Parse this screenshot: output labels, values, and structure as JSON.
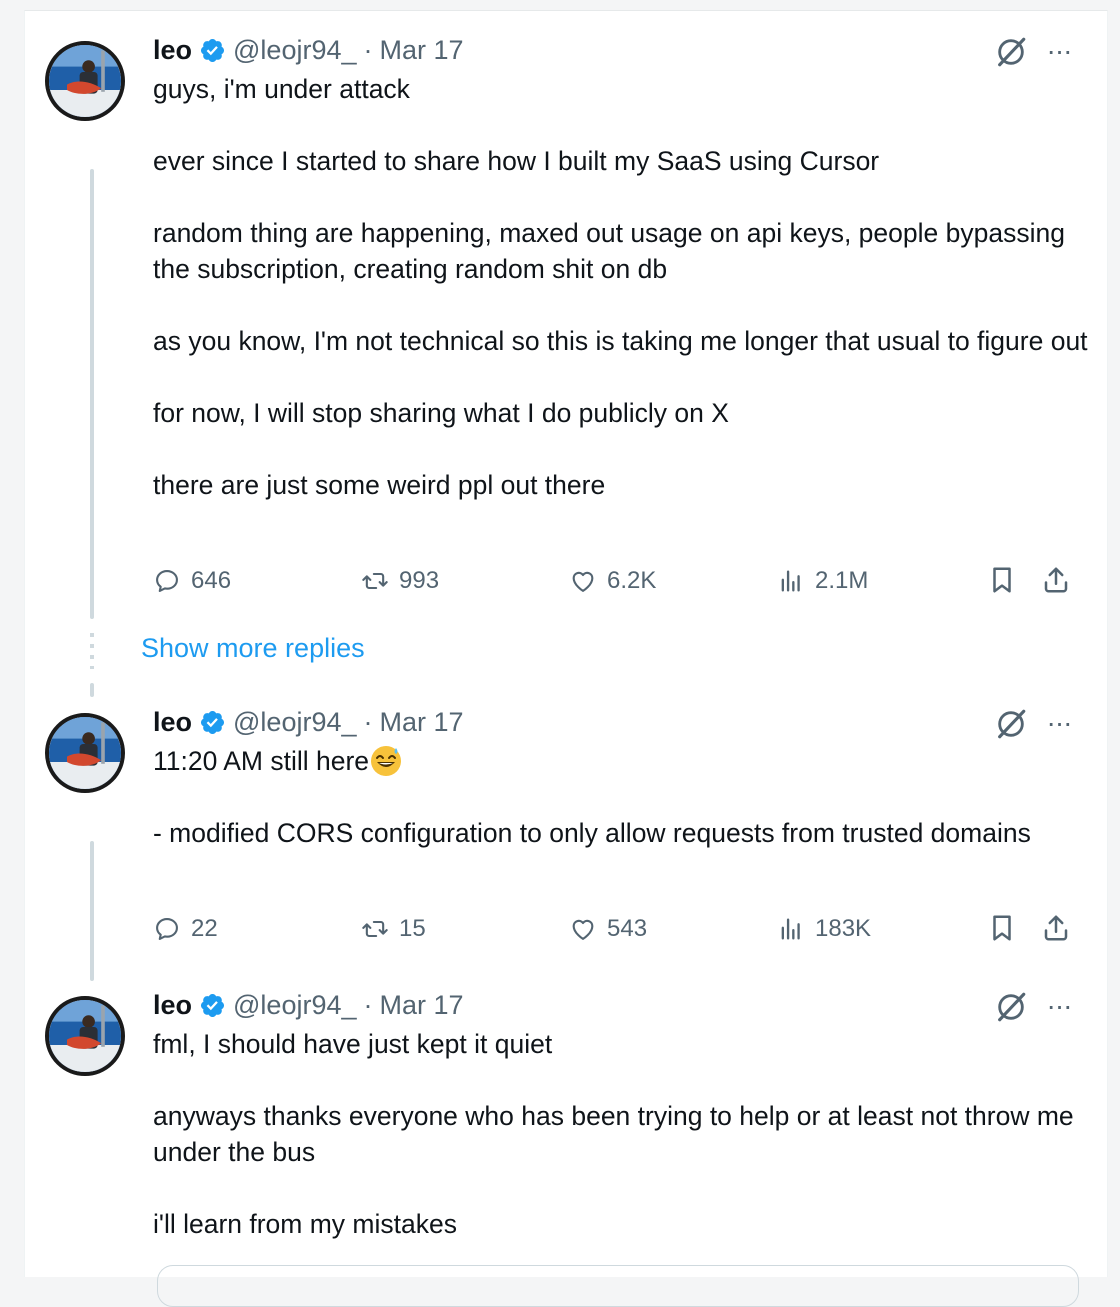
{
  "posts": [
    {
      "name": "leo",
      "handle": "@leojr94_",
      "separator": "·",
      "date": "Mar 17",
      "text": "guys, i'm under attack\n\never since I started to share how I built my SaaS using Cursor\n\nrandom thing are happening, maxed out usage on api keys, people bypassing the subscription, creating random shit on db\n\nas you know, I'm not technical so this is taking me longer that usual to figure out\n\nfor now, I will stop sharing what I do publicly on X\n\nthere are just some weird ppl out there",
      "replies": "646",
      "reposts": "993",
      "likes": "6.2K",
      "views": "2.1M"
    },
    {
      "name": "leo",
      "handle": "@leojr94_",
      "separator": "·",
      "date": "Mar 17",
      "text": "11:20 AM still here",
      "text2": "- modified CORS configuration to only allow requests from trusted domains",
      "replies": "22",
      "reposts": "15",
      "likes": "543",
      "views": "183K"
    },
    {
      "name": "leo",
      "handle": "@leojr94_",
      "separator": "·",
      "date": "Mar 17",
      "text": "fml, I should have just kept it quiet\n\nanyways thanks everyone who has been trying to help or at least not throw me under the bus\n\ni'll learn from my mistakes"
    }
  ],
  "show_more": "Show more replies",
  "more_glyph": "···",
  "colors": {
    "accent": "#1d9bf0",
    "text": "#0f1419",
    "muted": "#536471",
    "line": "#cfd9de"
  },
  "icons": [
    "verified-badge-icon",
    "grok-icon",
    "more-icon",
    "reply-icon",
    "repost-icon",
    "like-icon",
    "views-icon",
    "bookmark-icon",
    "share-icon",
    "grinning-sweat-emoji"
  ]
}
